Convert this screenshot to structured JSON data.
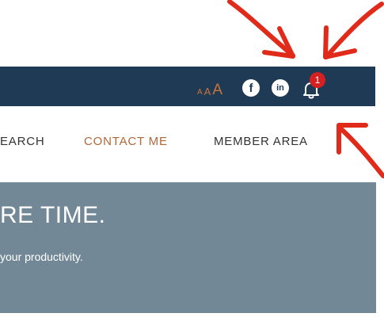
{
  "header": {
    "background": "#1e3a55",
    "font_size_controls": [
      "A",
      "A",
      "A"
    ],
    "font_size_color": "#c9733b",
    "social_icons": [
      {
        "name": "facebook-icon",
        "glyph": "f"
      },
      {
        "name": "linkedin-icon",
        "glyph": "in"
      }
    ],
    "notifications": {
      "icon": "bell-icon",
      "badge_count": "1",
      "badge_color": "#d42020"
    }
  },
  "nav": {
    "items": [
      {
        "label": "EARCH",
        "active": false
      },
      {
        "label": "CONTACT ME",
        "active": true
      },
      {
        "label": "MEMBER AREA",
        "active": false
      }
    ],
    "active_color": "#b0673a"
  },
  "hero": {
    "background": "#738897",
    "title": "RE TIME.",
    "subtitle": "your productivity."
  },
  "annotations": {
    "arrow_color": "#e02a1a",
    "arrow_count": 3
  }
}
